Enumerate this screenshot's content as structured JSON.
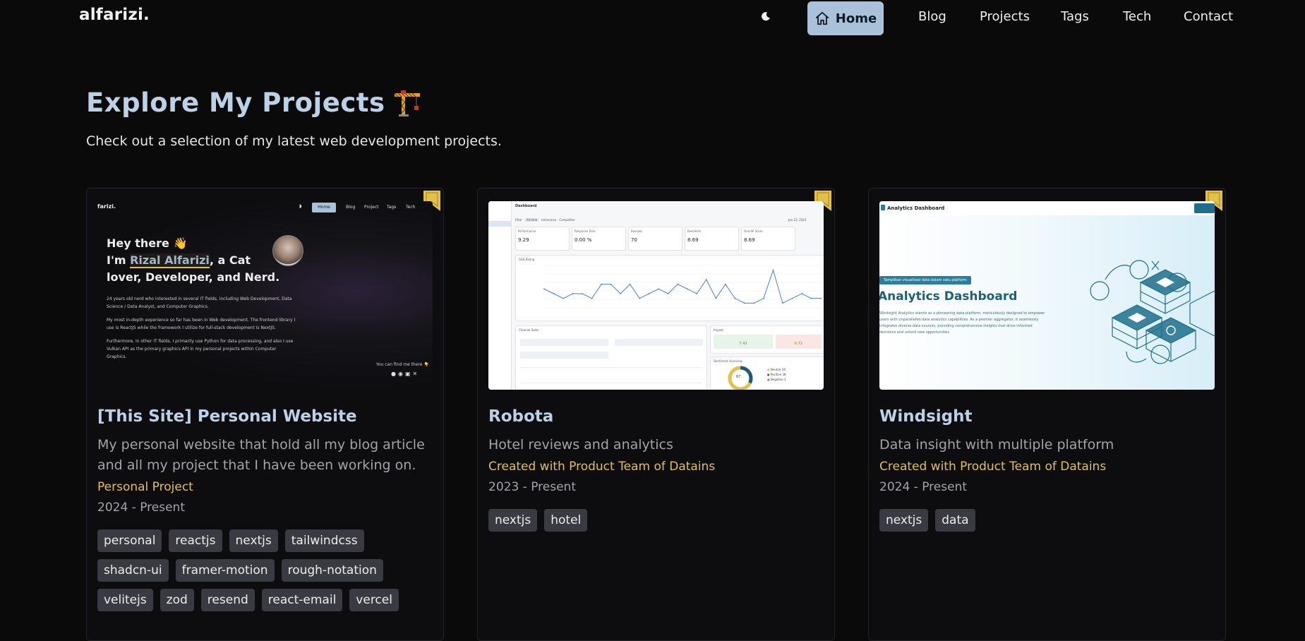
{
  "nav": {
    "logo": "alfarizi.",
    "home_label": "Home",
    "links": [
      "Blog",
      "Projects",
      "Tags",
      "Tech",
      "Contact"
    ]
  },
  "hero": {
    "title": "Explore My Projects",
    "subtitle": "Check out a selection of my latest web development projects."
  },
  "colors": {
    "accent": "#bcd1e6",
    "home_bg": "#a9c1d9",
    "team": "#e2c14a",
    "bookmark": "#e2c14a",
    "tag_bg": "#3a3a42"
  },
  "projects": [
    {
      "title": "[This Site] Personal Website",
      "description": "My personal website that hold all my blog article and all my project that I have been working on.",
      "team": "Personal Project",
      "date": "2024 - Present",
      "tags": [
        "personal",
        "reactjs",
        "nextjs",
        "tailwindcss",
        "shadcn-ui",
        "framer-motion",
        "rough-notation",
        "velitejs",
        "zod",
        "resend",
        "react-email",
        "vercel"
      ],
      "thumb": {
        "logo": "farizi.",
        "nav": [
          "Home",
          "Blog",
          "Project",
          "Tags",
          "Tech"
        ],
        "greeting": "Hey there 👋",
        "intro_line1": "I'm",
        "intro_name": "Rizal Alfarizi",
        "intro_line1_rest": ", a Cat",
        "intro_line2": "lover, Developer, and Nerd.",
        "p1": "24 years old nerd who interested in several IT fields, including Web Development, Data Science / Data Analyst, and Computer Graphics.",
        "p2": "My most in-depth experience so far has been in Web development. The frontend library I use is ReactJS while the framework I utilize for full-stack development is NextJS.",
        "p3": "Furthermore, in other IT fields, I primarily use Python for data processing, and also I use Vulkan API as the primary graphics API in my personal projects within Computer Graphics.",
        "find_me": "You can find me there 👇"
      }
    },
    {
      "title": "Robota",
      "description": "Hotel reviews and analytics",
      "team": "Created with Product Team of Datains",
      "date": "2023 - Present",
      "tags": [
        "nextjs",
        "hotel"
      ],
      "thumb": {
        "heading": "Dashboard",
        "filters": [
          "Filter",
          "All time",
          "Immersive",
          "Competitor"
        ],
        "date_range": "Jan 23, 2024",
        "stats": [
          {
            "label": "Performance",
            "value": "9.29"
          },
          {
            "label": "Response Rate",
            "value": "0.00 %"
          },
          {
            "label": "Reviews",
            "value": "70"
          },
          {
            "label": "Residents",
            "value": "8.69"
          },
          {
            "label": "Overall Score",
            "value": "8.69"
          }
        ],
        "chart_label": "GSS Rating",
        "line_values": [
          4,
          3,
          2,
          3,
          3,
          2,
          5,
          5,
          3,
          5,
          2,
          3,
          4,
          3,
          5,
          4,
          3,
          6,
          2,
          5,
          2,
          1,
          1,
          2,
          8,
          1,
          2,
          3,
          2,
          2
        ],
        "panel_left_label": "Channel Sales",
        "impact_label": "Impact",
        "impact_values": [
          "7.42",
          "6.72"
        ],
        "ring_label": "Sentiment Overview",
        "ring_value": "67",
        "legend": [
          "Neutral",
          "Positive",
          "Negative"
        ],
        "legend_values": [
          "26",
          "38",
          "3"
        ]
      }
    },
    {
      "title": "Windsight",
      "description": "Data insight with multiple platform",
      "team": "Created with Product Team of Datains",
      "date": "2024 - Present",
      "tags": [
        "nextjs",
        "data"
      ],
      "thumb": {
        "app_name": "Analytics Dashboard",
        "pill": "Tampilkan visualisasi data dalam satu platform",
        "headline": "Analytics Dashboard",
        "body": "Windsight Analytics stands as a pioneering data platform, meticulously designed to empower users with unparalleled data analytics capabilities. As a premier aggregator, it seamlessly integrates diverse data sources, providing comprehensive insights that drive informed decisions and unlock new opportunities."
      }
    }
  ]
}
